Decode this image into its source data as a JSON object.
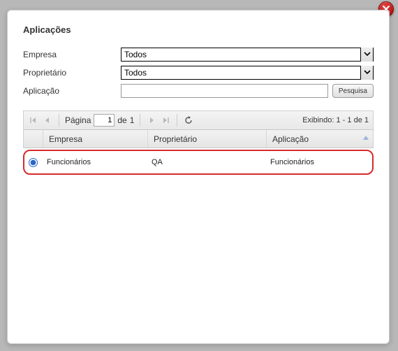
{
  "dialog": {
    "title": "Aplicações"
  },
  "form": {
    "empresa_label": "Empresa",
    "empresa_value": "Todos",
    "proprietario_label": "Proprietário",
    "proprietario_value": "Todos",
    "aplicacao_label": "Aplicação",
    "aplicacao_value": "",
    "search_label": "Pesquisa"
  },
  "toolbar": {
    "page_label": "Página",
    "page_value": "1",
    "of_label": "de",
    "total_pages": "1",
    "display_info": "Exibindo: 1 - 1 de 1"
  },
  "grid": {
    "headers": {
      "empresa": "Empresa",
      "proprietario": "Proprietário",
      "aplicacao": "Aplicação"
    },
    "rows": [
      {
        "empresa": "Funcionários",
        "proprietario": "QA",
        "aplicacao": "Funcionários"
      }
    ]
  }
}
